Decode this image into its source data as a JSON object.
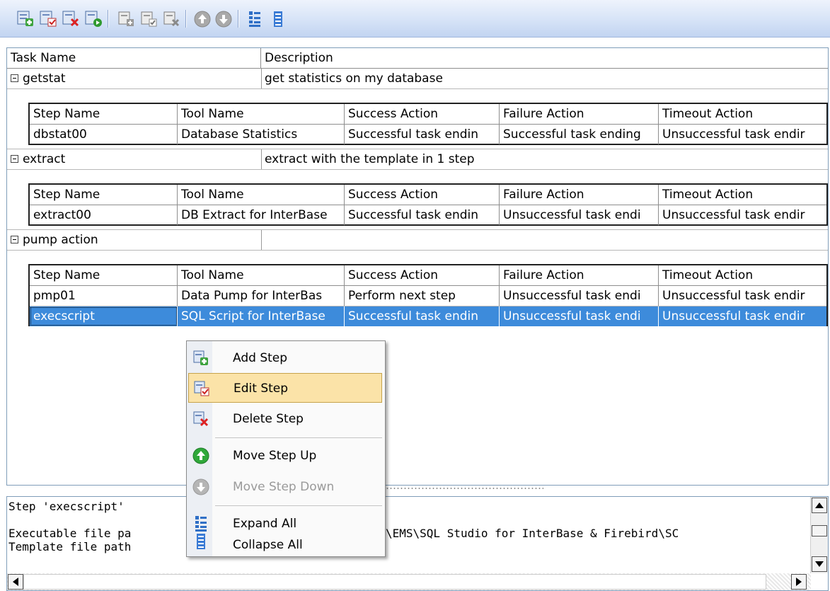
{
  "toolbar": {
    "buttons": [
      "add-task-icon",
      "edit-task-icon",
      "delete-task-icon",
      "run-task-icon",
      "add-step-icon",
      "edit-step-icon",
      "delete-step-icon",
      "move-up-icon",
      "move-down-icon",
      "expand-all-icon",
      "collapse-all-icon"
    ]
  },
  "grid": {
    "columns": {
      "task_name": "Task Name",
      "description": "Description"
    },
    "step_columns": {
      "step": "Step Name",
      "tool": "Tool Name",
      "success": "Success Action",
      "failure": "Failure Action",
      "timeout": "Timeout Action"
    },
    "tasks": [
      {
        "name": "getstat",
        "description": "get statistics on my database",
        "steps": [
          {
            "step": "dbstat00",
            "tool": "Database Statistics",
            "success": "Successful task endin",
            "failure": "Successful task ending",
            "timeout": "Unsuccessful task endir"
          }
        ]
      },
      {
        "name": "extract",
        "description": "extract with the template in 1 step",
        "steps": [
          {
            "step": "extract00",
            "tool": "DB Extract for InterBase",
            "success": "Successful task endin",
            "failure": "Unsuccessful task endi",
            "timeout": "Unsuccessful task endir"
          }
        ]
      },
      {
        "name": "pump action",
        "description": "",
        "steps": [
          {
            "step": "pmp01",
            "tool": "Data Pump for InterBas",
            "success": "Perform next step",
            "failure": "Unsuccessful task endi",
            "timeout": "Unsuccessful task endir"
          },
          {
            "step": "execscript",
            "tool": "SQL Script for InterBase",
            "success": "Successful task endin",
            "failure": "Unsuccessful task endi",
            "timeout": "Unsuccessful task endir"
          }
        ]
      }
    ]
  },
  "log": {
    "lines": [
      "Step 'execscript'",
      "",
      "Executable file pa",
      "Template file path"
    ],
    "path_fragment": "\\EMS\\SQL Studio for InterBase & Firebird\\SC"
  },
  "context_menu": {
    "items": [
      {
        "label": "Add Step",
        "icon": "add-step-icon",
        "state": "normal"
      },
      {
        "label": "Edit Step",
        "icon": "edit-step-icon",
        "state": "hover"
      },
      {
        "label": "Delete Step",
        "icon": "delete-step-icon",
        "state": "normal"
      },
      {
        "label": "Move Step Up",
        "icon": "move-up-icon",
        "state": "normal"
      },
      {
        "label": "Move Step Down",
        "icon": "move-down-icon",
        "state": "disabled"
      },
      {
        "label": "Expand All",
        "icon": "expand-all-icon",
        "state": "normal"
      },
      {
        "label": "Collapse All",
        "icon": "collapse-all-icon",
        "state": "normal"
      }
    ]
  },
  "colors": {
    "selection": "#3d8bdb",
    "menu_hover": "#fbe3a8",
    "toolbar_top": "#eef3fc",
    "toolbar_bottom": "#c2d4f1"
  }
}
